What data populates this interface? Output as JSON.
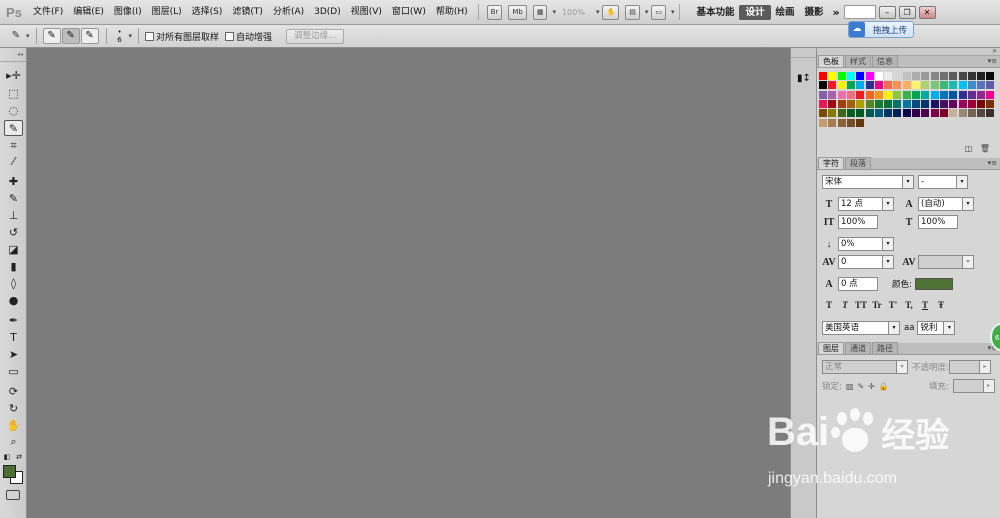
{
  "menubar": {
    "logo": "Ps",
    "menus": [
      "文件(F)",
      "编辑(E)",
      "图像(I)",
      "图层(L)",
      "选择(S)",
      "滤镜(T)",
      "分析(A)",
      "3D(D)",
      "视图(V)",
      "窗口(W)",
      "帮助(H)"
    ],
    "bridge_label": "Br",
    "minibridge_label": "Mb",
    "zoom": "100%",
    "workspaces": [
      "基本功能",
      "设计",
      "绘画",
      "摄影"
    ],
    "active_workspace": "设计",
    "more": "»"
  },
  "upload_tip": {
    "label": "拖拽上传"
  },
  "options": {
    "brush_size": "6",
    "sample_all_layers": "对所有图层取样",
    "auto_enhance": "自动增强",
    "refine_edge": "调整边缘..."
  },
  "swatches": {
    "tabs": [
      "色板",
      "样式",
      "信息"
    ],
    "colors": [
      "#ff0000",
      "#ffff00",
      "#00ff00",
      "#00ffff",
      "#0000ff",
      "#ff00ff",
      "#ffffff",
      "#ebebeb",
      "#d6d6d6",
      "#c2c2c2",
      "#adadad",
      "#999999",
      "#858585",
      "#707070",
      "#5c5c5c",
      "#474747",
      "#333333",
      "#1f1f1f",
      "#0a0a0a",
      "#000000",
      "#ed1c24",
      "#fff200",
      "#00a651",
      "#00aeef",
      "#2e3192",
      "#ec008c",
      "#f26c4f",
      "#f68e55",
      "#fbaf5c",
      "#fff467",
      "#acd372",
      "#7cc576",
      "#3bb878",
      "#1abbb4",
      "#00bff3",
      "#438cca",
      "#5574b9",
      "#605ca8",
      "#855fa8",
      "#a763a8",
      "#f06eaa",
      "#f26d7d",
      "#ed1c24",
      "#f26522",
      "#f7941d",
      "#fff200",
      "#8dc63f",
      "#39b54a",
      "#00a651",
      "#00a99d",
      "#00aeef",
      "#0072bc",
      "#0054a6",
      "#2e3192",
      "#662d91",
      "#92278f",
      "#ec008c",
      "#ed145b",
      "#9e0b0f",
      "#a0410d",
      "#a3620a",
      "#aba000",
      "#598527",
      "#1a7b30",
      "#007236",
      "#00746b",
      "#0076a3",
      "#004b80",
      "#003471",
      "#1b1464",
      "#440e62",
      "#630460",
      "#9e005d",
      "#9e0039",
      "#790000",
      "#7b2e00",
      "#7d4900",
      "#827b00",
      "#406618",
      "#005e20",
      "#005826",
      "#005952",
      "#005b7f",
      "#003663",
      "#002157",
      "#0d004c",
      "#32004b",
      "#4b0049",
      "#7b0046",
      "#7a0026",
      "#c7b299",
      "#998675",
      "#736357",
      "#534741",
      "#37302d",
      "#c69c6d",
      "#a67c52",
      "#8c6239",
      "#754c24",
      "#603913"
    ]
  },
  "character": {
    "tabs": [
      "字符",
      "段落"
    ],
    "font_family": "宋体",
    "font_style": "-",
    "size": "12 点",
    "leading": "(自动)",
    "vertical_scale": "100%",
    "horizontal_scale": "100%",
    "kerning_pct": "0%",
    "tracking": "0",
    "kerning_metric": "",
    "baseline_shift": "0 点",
    "color_label": "颜色:",
    "color": "#4e7233",
    "styles": [
      "T",
      "T",
      "TT",
      "Tr",
      "T'",
      "T,",
      "T",
      "Ŧ"
    ],
    "language": "美国英语",
    "aa_label": "aa",
    "antialias": "锐利"
  },
  "layers": {
    "tabs": [
      "图层",
      "通道",
      "路径"
    ],
    "blend_mode": "正常",
    "opacity_label": "不透明度:",
    "lock_label": "锁定:",
    "fill_label": "填充:"
  },
  "watermark": {
    "left": "Bai",
    "right": "经验",
    "url": "jingyan.baidu.com"
  },
  "colors": {
    "foreground": "#4d6e33",
    "background": "#ffffff",
    "canvas": "#7c7c7c"
  }
}
